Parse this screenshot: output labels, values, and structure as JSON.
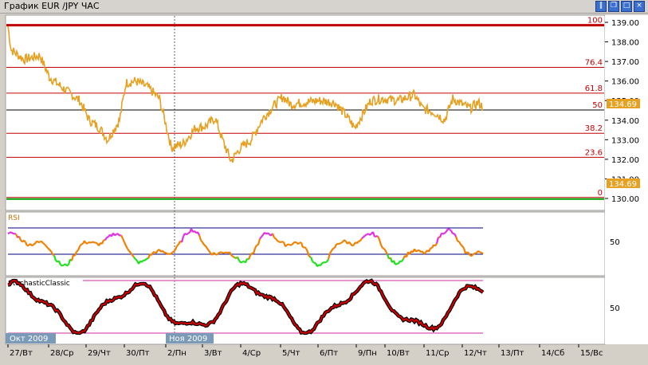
{
  "window": {
    "title": "График EUR /JPY  ЧАС",
    "buttons": [
      "pause-icon",
      "restore-icon",
      "maximize-icon",
      "close-icon"
    ]
  },
  "price_axis": {
    "ticks": [
      "139.00",
      "138.00",
      "137.00",
      "136.00",
      "135.00",
      "134.00",
      "133.00",
      "132.00",
      "131.00",
      "130.00"
    ],
    "min": 129.5,
    "max": 139.5,
    "current_price": "134.69",
    "current_value": 134.69,
    "price_tag_color": "#e8a020"
  },
  "fibonacci": {
    "color": "#c00000",
    "levels": [
      {
        "label": "100",
        "price": 138.85
      },
      {
        "label": "76.4",
        "price": 136.7
      },
      {
        "label": "61.8",
        "price": 135.38
      },
      {
        "label": "50",
        "price": 134.52
      },
      {
        "label": "38.2",
        "price": 133.33
      },
      {
        "label": "23.6",
        "price": 132.1
      },
      {
        "label": "0",
        "price": 130.05
      }
    ]
  },
  "rsi": {
    "title": "RSI",
    "level_label": "50",
    "upper": 70,
    "lower": 30,
    "title_color": "#c07000"
  },
  "stochastic": {
    "title": "StochasticClassic",
    "level_label": "50",
    "upper": 80,
    "lower": 20
  },
  "date_axis": {
    "labels": [
      "27/Вт",
      "28/Ср",
      "29/Чт",
      "30/Пт",
      "2/Пн",
      "3/Вт",
      "4/Ср",
      "5/Чт",
      "6/Пт",
      "9/Пн",
      "10/Вт",
      "11/Ср",
      "12/Чт",
      "13/Пт",
      "14/Сб",
      "15/Вс"
    ],
    "month_badges": [
      "Окт 2009",
      "Ноя 2009"
    ]
  },
  "colors": {
    "background": "#ffffff",
    "price_line": "#e8a020",
    "rsi_line": "#f08000",
    "rsi_low": "#20e020",
    "rsi_high": "#e030e0",
    "stoch_line": "#d00000",
    "stoch_shadow": "#000000",
    "band_line": "#000080",
    "stoch_band": "#e070c0",
    "zero_line": "#00a000"
  }
}
